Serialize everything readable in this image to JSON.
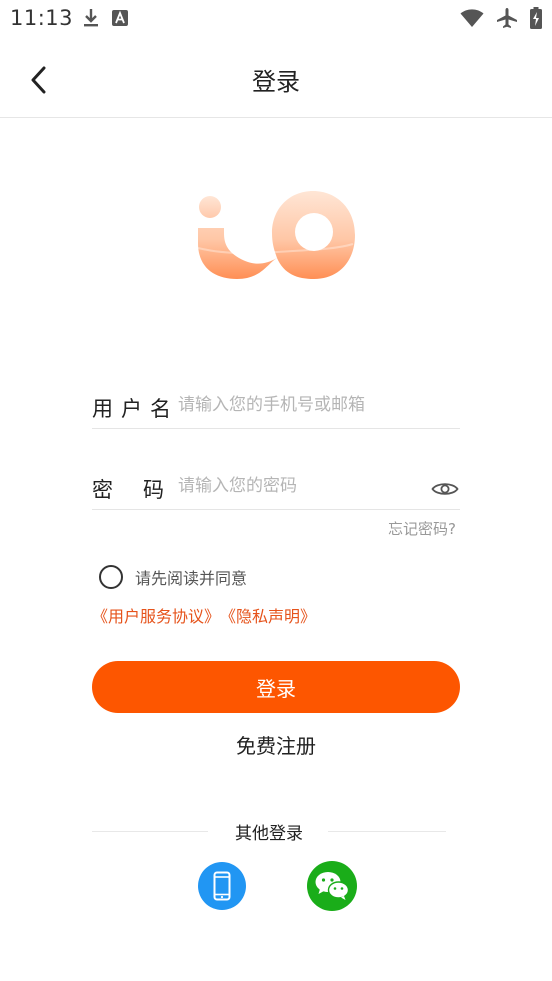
{
  "status_bar": {
    "time": "11:13",
    "icons": [
      "download-icon",
      "keyboard-a-icon",
      "wifi-icon",
      "airplane-icon",
      "battery-charging-icon"
    ]
  },
  "app_bar": {
    "title": "登录",
    "back_icon": "chevron-left-icon"
  },
  "form": {
    "username": {
      "label": "用户名",
      "placeholder": "请输入您的手机号或邮箱",
      "value": ""
    },
    "password": {
      "label": "密码",
      "placeholder": "请输入您的密码",
      "value": "",
      "toggle_icon": "eye-icon"
    },
    "forgot": "忘记密码?",
    "agree_text": "请先阅读并同意",
    "agreement_link": "《用户服务协议》",
    "privacy_link": "《隐私声明》",
    "login_label": "登录",
    "register_label": "免费注册"
  },
  "other_login": {
    "label": "其他登录",
    "options": [
      "phone-icon",
      "wechat-icon"
    ]
  },
  "colors": {
    "accent": "#fd5600",
    "link": "#e6531b",
    "phone_blue": "#2196f3",
    "wechat_green": "#1aad19"
  }
}
